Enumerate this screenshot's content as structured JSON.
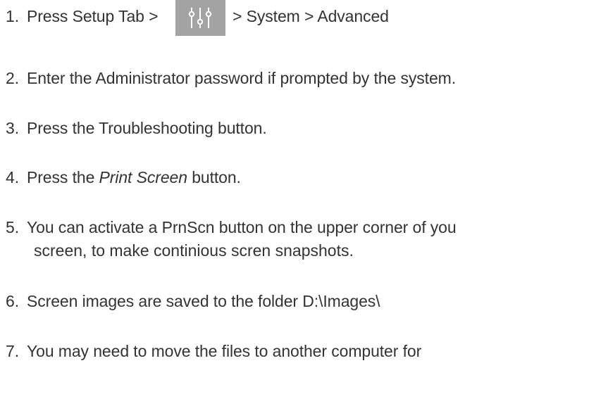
{
  "steps": [
    {
      "num": "1.",
      "before_icon": "Press Setup Tab >",
      "icon": "settings-sliders-icon",
      "after_icon": "> System > Advanced"
    },
    {
      "num": "2.",
      "text": "Enter the Administrator password if prompted by the system."
    },
    {
      "num": "3.",
      "text": "Press the Troubleshooting button."
    },
    {
      "num": "4.",
      "text_before": "Press the ",
      "text_italic": "Print Screen",
      "text_after": " button."
    },
    {
      "num": "5.",
      "line1": "You can activate a PrnScn button on the upper corner of you",
      "line2": "screen, to make continious scren snapshots."
    },
    {
      "num": "6.",
      "text": "Screen images are saved to the folder D:\\Images\\"
    },
    {
      "num": "7.",
      "text": "You may need to move the files to another computer for"
    }
  ],
  "colors": {
    "text": "#333333",
    "icon_tile": "#a3a3a3",
    "icon_glyph": "#ffffff"
  }
}
